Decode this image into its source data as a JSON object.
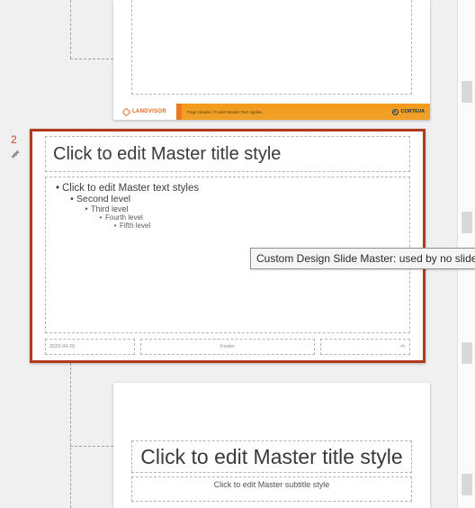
{
  "top_slide": {
    "logo_text": "LANDVISOR",
    "footer_tiny_text": "Page Header / Footer Master Text Applies",
    "brand_text": "CORTEVA"
  },
  "master_slide": {
    "index": "2",
    "title_placeholder": "Click to edit Master title style",
    "levels": {
      "l1": "Click to edit Master text styles",
      "l2": "Second level",
      "l3": "Third level",
      "l4": "Fourth level",
      "l5": "Fifth level"
    },
    "date_placeholder": "2023-04-20",
    "footer_placeholder": "Footer",
    "slidenum_placeholder": "‹#›"
  },
  "tooltip": "Custom Design Slide Master: used by no slides",
  "layout_slide": {
    "title_placeholder": "Click to edit Master title style",
    "subtitle_placeholder": "Click to edit Master subtitle style"
  }
}
